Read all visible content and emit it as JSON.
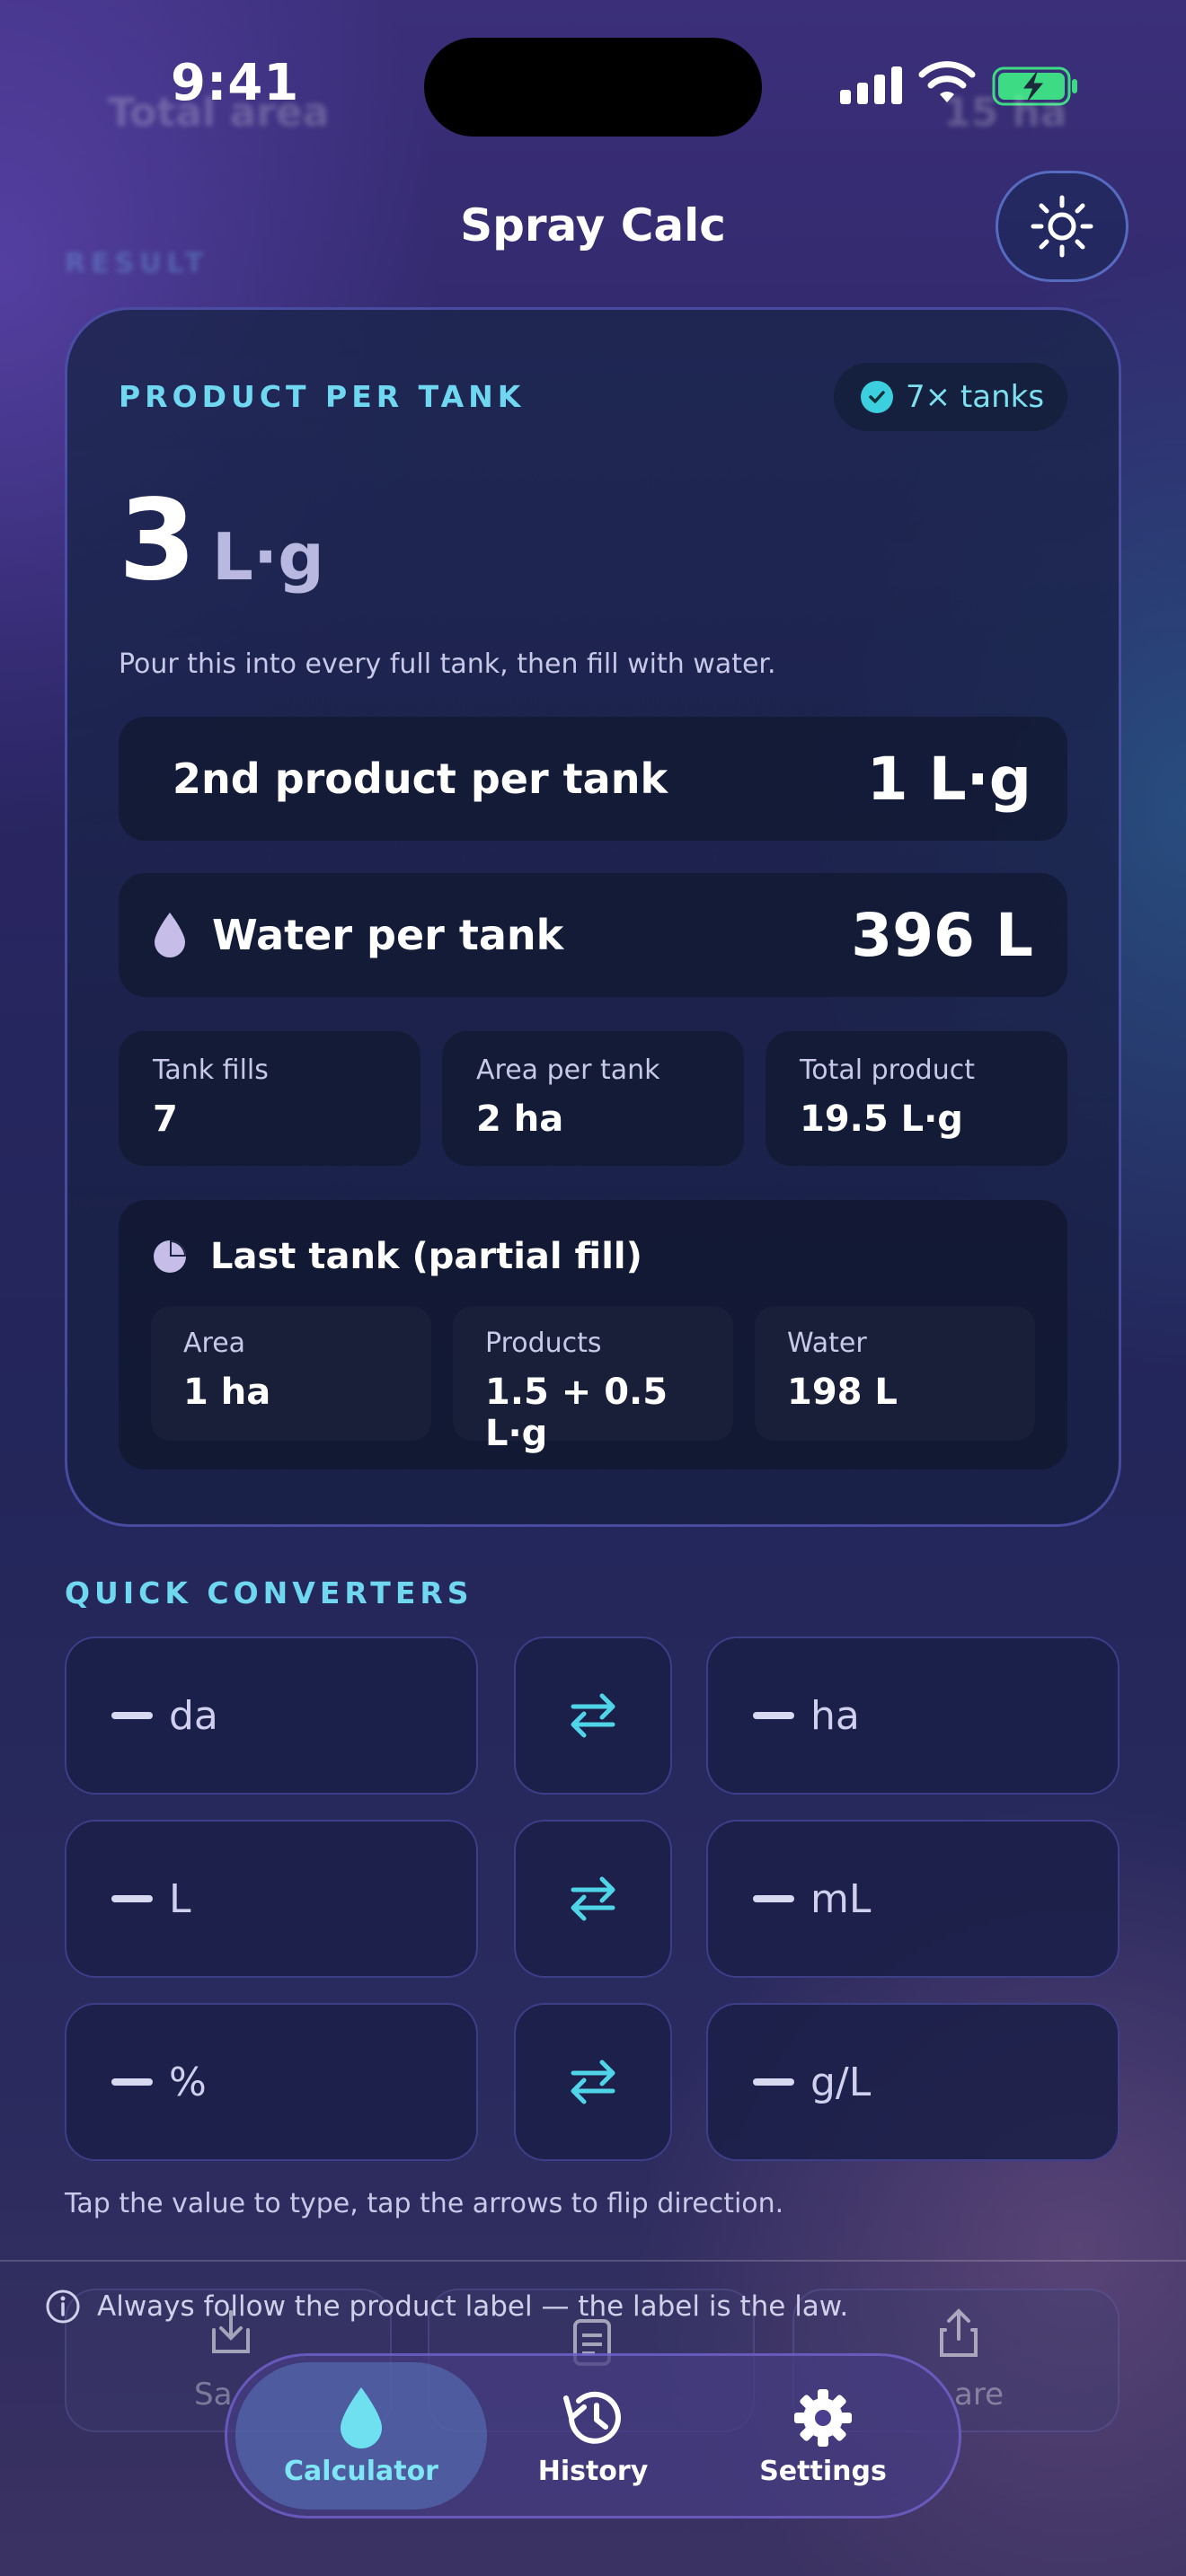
{
  "status": {
    "time": "9:41"
  },
  "ghost": {
    "total_label": "Total area",
    "total_value": "15 ha",
    "result_label": "RESULT"
  },
  "header": {
    "title": "Spray Calc"
  },
  "result": {
    "label": "PRODUCT PER TANK",
    "tanks_badge": "7× tanks",
    "value": "3",
    "unit": "L·g",
    "note": "Pour this into every full tank, then fill with water.",
    "second_product_label": "2nd product per tank",
    "second_product_value": "1 L·g",
    "water_label": "Water per tank",
    "water_value": "396 L",
    "stats": [
      {
        "key": "Tank fills",
        "value": "7"
      },
      {
        "key": "Area per tank",
        "value": "2 ha"
      },
      {
        "key": "Total product",
        "value": "19.5 L·g"
      }
    ],
    "last_tank": {
      "title": "Last tank (partial fill)",
      "items": [
        {
          "key": "Area",
          "value": "1 ha"
        },
        {
          "key": "Products",
          "value": "1.5 + 0.5 L·g"
        },
        {
          "key": "Water",
          "value": "198 L"
        }
      ]
    }
  },
  "converters": {
    "label": "QUICK CONVERTERS",
    "rows": [
      {
        "left_unit": "da",
        "right_unit": "ha"
      },
      {
        "left_unit": "L",
        "right_unit": "mL"
      },
      {
        "left_unit": "%",
        "right_unit": "g/L"
      }
    ],
    "placeholder_dash": "—",
    "hint": "Tap the value to type, tap the arrows to flip direction."
  },
  "disclaimer": "Always follow the product label — the label is the law.",
  "ghost_actions": {
    "save": "Sa",
    "share": "are"
  },
  "tabs": [
    {
      "label": "Calculator",
      "icon": "droplet-icon"
    },
    {
      "label": "History",
      "icon": "history-icon"
    },
    {
      "label": "Settings",
      "icon": "gear-icon"
    }
  ],
  "colors": {
    "accent": "#6fd8f0",
    "active_tab": "#7ee6f4",
    "battery": "#3ddc84"
  }
}
